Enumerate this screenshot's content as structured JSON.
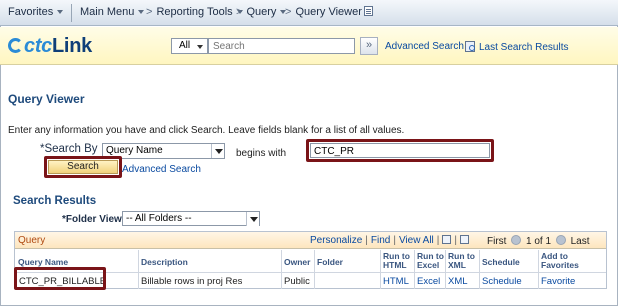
{
  "topnav": {
    "favorites": "Favorites",
    "main_menu": "Main Menu",
    "crumbs": [
      "Reporting Tools",
      "Query",
      "Query Viewer"
    ]
  },
  "header": {
    "logo_c": "ctc",
    "logo_link": "Link",
    "scope": "All",
    "search_placeholder": "Search",
    "advanced_search": "Advanced Search",
    "last_results": "Last Search Results"
  },
  "page": {
    "title": "Query Viewer",
    "instructions": "Enter any information you have and click Search. Leave fields blank for a list of all values.",
    "search_by_label": "*Search By",
    "search_by_value": "Query Name",
    "operator": "begins with",
    "criteria": "CTC_PR",
    "search_button": "Search",
    "advanced_link": "Advanced Search"
  },
  "results": {
    "title": "Search Results",
    "folder_label": "*Folder View",
    "folder_value": "-- All Folders --",
    "grid_title": "Query",
    "tools": {
      "personalize": "Personalize",
      "find": "Find",
      "view_all": "View All"
    },
    "nav": {
      "first": "First",
      "range": "1 of 1",
      "last": "Last"
    },
    "columns": {
      "query_name": "Query Name",
      "description": "Description",
      "owner": "Owner",
      "folder": "Folder",
      "run_html_1": "Run to",
      "run_html_2": "HTML",
      "run_excel_1": "Run to",
      "run_excel_2": "Excel",
      "run_xml_1": "Run to",
      "run_xml_2": "XML",
      "schedule": "Schedule",
      "fav_1": "Add to",
      "fav_2": "Favorites"
    },
    "rows": [
      {
        "query_name": "CTC_PR_BILLABLE",
        "description": "Billable rows in proj Res",
        "owner": "Public",
        "folder": "",
        "html": "HTML",
        "excel": "Excel",
        "xml": "XML",
        "schedule": "Schedule",
        "favorite": "Favorite"
      }
    ]
  },
  "colors": {
    "highlight": "#7a1418",
    "brand": "#0f5fa8",
    "link": "#0a4aa0"
  }
}
